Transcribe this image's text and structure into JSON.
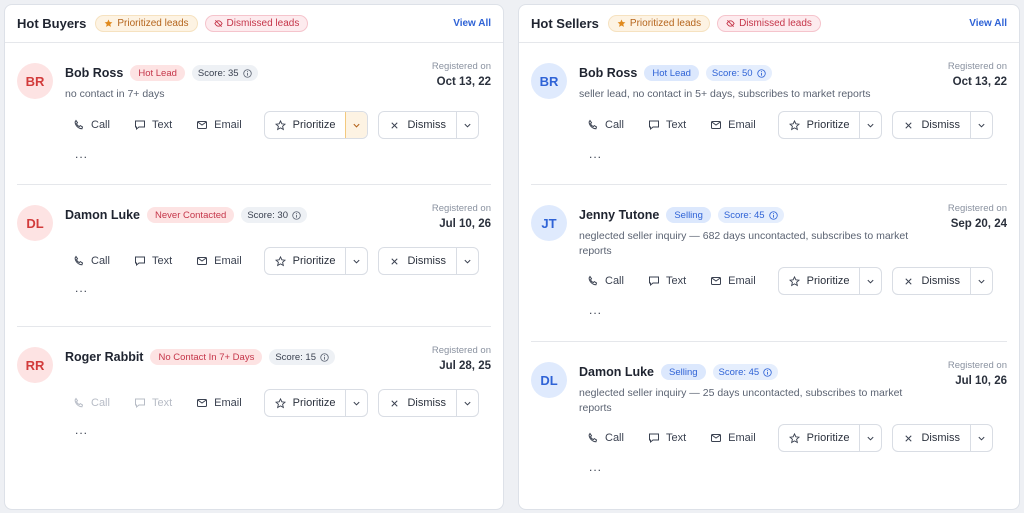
{
  "buyers": {
    "title": "Hot Buyers",
    "chip_prioritized": "Prioritized leads",
    "chip_dismissed": "Dismissed leads",
    "view_all": "View All",
    "leads": [
      {
        "initials": "BR",
        "name": "Bob Ross",
        "tag": "Hot Lead",
        "score": "Score: 35",
        "desc": "no contact in 7+ days",
        "reg_label": "Registered on",
        "reg_date": "Oct 13, 22"
      },
      {
        "initials": "DL",
        "name": "Damon Luke",
        "tag": "Never Contacted",
        "score": "Score: 30",
        "desc": "",
        "reg_label": "Registered on",
        "reg_date": "Jul 10, 26"
      },
      {
        "initials": "RR",
        "name": "Roger Rabbit",
        "tag": "No Contact In 7+ Days",
        "score": "Score: 15",
        "desc": "",
        "reg_label": "Registered on",
        "reg_date": "Jul 28, 25"
      }
    ]
  },
  "sellers": {
    "title": "Hot Sellers",
    "chip_prioritized": "Prioritized leads",
    "chip_dismissed": "Dismissed leads",
    "view_all": "View All",
    "leads": [
      {
        "initials": "BR",
        "name": "Bob Ross",
        "tag": "Hot Lead",
        "score": "Score: 50",
        "desc": "seller lead, no contact in 5+ days, subscribes to market reports",
        "reg_label": "Registered on",
        "reg_date": "Oct 13, 22"
      },
      {
        "initials": "JT",
        "name": "Jenny Tutone",
        "tag": "Selling",
        "score": "Score: 45",
        "desc": "neglected seller inquiry — 682 days uncontacted, subscribes to market reports",
        "reg_label": "Registered on",
        "reg_date": "Sep 20, 24"
      },
      {
        "initials": "DL",
        "name": "Damon Luke",
        "tag": "Selling",
        "score": "Score: 45",
        "desc": "neglected seller inquiry — 25 days uncontacted, subscribes to market reports",
        "reg_label": "Registered on",
        "reg_date": "Jul 10, 26"
      }
    ]
  },
  "actions": {
    "call": "Call",
    "text": "Text",
    "email": "Email",
    "prioritize": "Prioritize",
    "dismiss": "Dismiss",
    "more": "..."
  },
  "colors": {
    "accent_blue": "#2f63d6",
    "lead_red": "#d23b3b",
    "prioritized_orange": "#b5651d",
    "dismissed_red": "#c5364a"
  }
}
